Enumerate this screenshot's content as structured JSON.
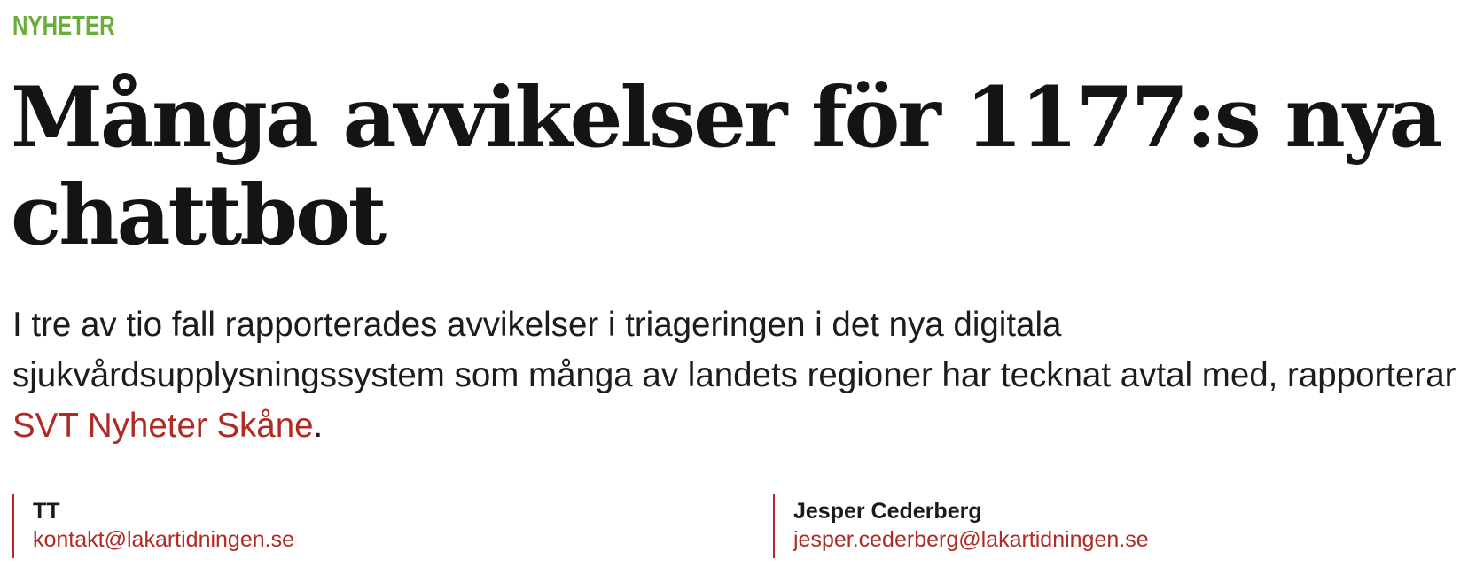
{
  "article": {
    "category": "NYHETER",
    "headline": "Många avvikelser för 1177:s nya chattbot",
    "lead_text": "I tre av tio fall rapporterades avvikelser i triageringen i det nya digitala sjukvårdsupplysningssystem som många av landets regioner har tecknat avtal med, rapporterar ",
    "lead_link": "SVT Nyheter Skåne",
    "lead_end": ".",
    "authors": [
      {
        "name": "TT",
        "email": "kontakt@lakartidningen.se"
      },
      {
        "name": "Jesper Cederberg",
        "email": "jesper.cederberg@lakartidningen.se"
      }
    ]
  },
  "colors": {
    "category": "#6aae3a",
    "accent": "#b02a24",
    "text": "#141414"
  }
}
